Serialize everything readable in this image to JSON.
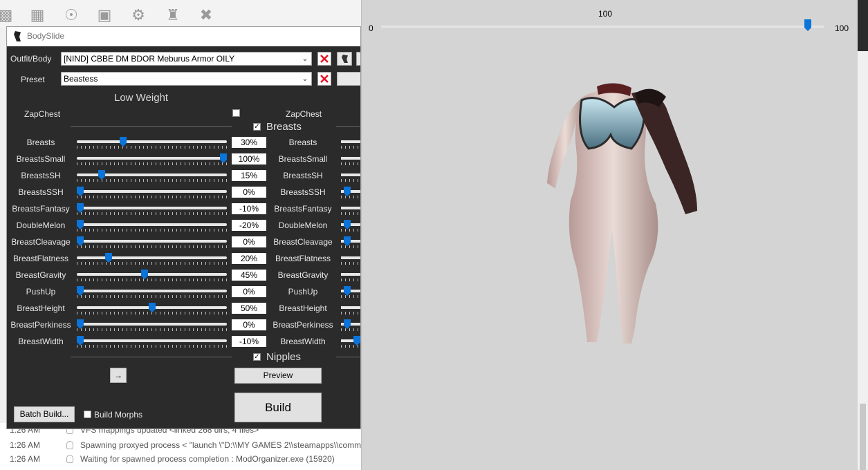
{
  "toolbar_icons": [
    "lock-icon",
    "archive-icon",
    "globe-icon",
    "id-card-icon",
    "gear-icon",
    "castle-icon",
    "wrench-icon"
  ],
  "window": {
    "title": "BodySlide"
  },
  "outfit": {
    "label": "Outfit/Body",
    "value": "[NIND] CBBE DM BDOR Meburus Armor OILY"
  },
  "preset": {
    "label": "Preset",
    "value": "Beastess"
  },
  "low_weight": {
    "title": "Low Weight",
    "zap_label_left": "ZapChest",
    "zap_label_right": "ZapChest"
  },
  "groups": {
    "breasts": "Breasts",
    "nipples": "Nipples"
  },
  "sliders": [
    {
      "name": "Breasts",
      "value": "30%",
      "pos": 0.3,
      "rpos": 0.95
    },
    {
      "name": "BreastsSmall",
      "value": "100%",
      "pos": 1.0,
      "rpos": 0.95
    },
    {
      "name": "BreastsSH",
      "value": "15%",
      "pos": 0.15,
      "rpos": 0.95
    },
    {
      "name": "BreastsSSH",
      "value": "0%",
      "pos": 0.0,
      "rpos": 0.1
    },
    {
      "name": "BreastsFantasy",
      "value": "-10%",
      "pos": 0.0,
      "rpos": 0.95
    },
    {
      "name": "DoubleMelon",
      "value": "-20%",
      "pos": 0.0,
      "rpos": 0.1
    },
    {
      "name": "BreastCleavage",
      "value": "0%",
      "pos": 0.0,
      "rpos": 0.1
    },
    {
      "name": "BreastFlatness",
      "value": "20%",
      "pos": 0.2,
      "rpos": 0.95
    },
    {
      "name": "BreastGravity",
      "value": "45%",
      "pos": 0.45,
      "rpos": 0.95
    },
    {
      "name": "PushUp",
      "value": "0%",
      "pos": 0.0,
      "rpos": 0.1
    },
    {
      "name": "BreastHeight",
      "value": "50%",
      "pos": 0.5,
      "rpos": 0.95
    },
    {
      "name": "BreastPerkiness",
      "value": "0%",
      "pos": 0.0,
      "rpos": 0.1
    },
    {
      "name": "BreastWidth",
      "value": "-10%",
      "pos": 0.0,
      "rpos": 0.45
    }
  ],
  "buttons": {
    "arrow": "→",
    "preview": "Preview",
    "build": "Build",
    "batch_build": "Batch Build...",
    "build_morphs": "Build Morphs"
  },
  "preview_slider": {
    "current": "100",
    "min": "0",
    "max": "100",
    "value": 1.0
  },
  "log": [
    {
      "time": "1:26 AM",
      "message": "VFS mappings updated <linked 268 dirs, 4 files>"
    },
    {
      "time": "1:26 AM",
      "message": "Spawning proxyed process < \"launch \\\"D:\\\\MY GAMES 2\\\\steamapps\\\\comm"
    },
    {
      "time": "1:26 AM",
      "message": "Waiting for spawned process completion : ModOrganizer.exe (15920)"
    }
  ],
  "colors": {
    "accent": "#0a74da",
    "panel": "#2b2b2b",
    "preview_bg": "#d4d4d4",
    "close_red": "#e81123"
  }
}
